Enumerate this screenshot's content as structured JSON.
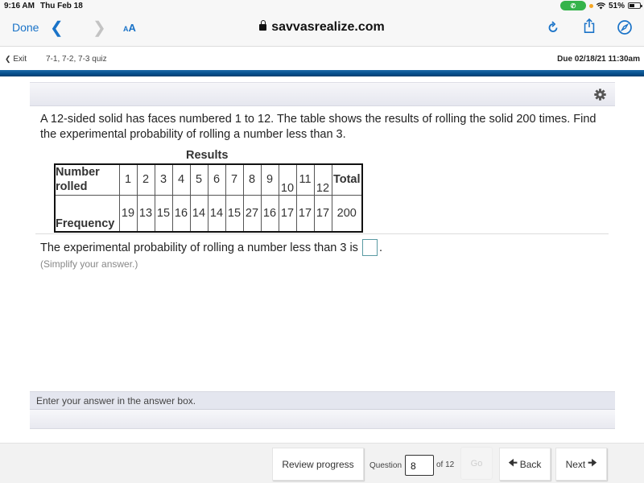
{
  "status_bar": {
    "time": "9:16 AM",
    "date": "Thu Feb 18",
    "battery_percent_label": "51%",
    "battery_level": 0.51,
    "icons": [
      "phone-call-icon",
      "mic-indicator-icon",
      "wifi-icon",
      "battery-icon"
    ]
  },
  "browser": {
    "done_label": "Done",
    "back_icon": "chevron-left-icon",
    "forward_icon": "chevron-right-icon",
    "text_size_label_small": "A",
    "text_size_label_large": "A",
    "url": "savvasrealize.com",
    "lock_icon": "lock-icon",
    "reload_icon": "reload-icon",
    "share_icon": "share-icon",
    "compass_icon": "compass-icon",
    "accent_color": "#1a73c8"
  },
  "app_bar": {
    "exit_label": "Exit",
    "quiz_title": "7-1, 7-2, 7-3 quiz",
    "due_label": "Due 02/18/21 11:30am",
    "brand_bar_color": "#064d8a"
  },
  "question": {
    "settings_icon": "gear-icon",
    "text": "A 12-sided solid has faces numbered 1 to 12. The table shows the results of rolling the solid 200 times. Find the experimental probability of rolling a number less than 3.",
    "table": {
      "title": "Results",
      "row1_header": "Number rolled",
      "row2_header": "Frequency",
      "numbers": [
        "1",
        "2",
        "3",
        "4",
        "5",
        "6",
        "7",
        "8",
        "9",
        "10",
        "11",
        "12"
      ],
      "frequencies": [
        "19",
        "13",
        "15",
        "16",
        "14",
        "14",
        "15",
        "27",
        "16",
        "17",
        "17",
        "17"
      ],
      "total_header": "Total",
      "total_value": "200"
    },
    "answer_prompt": "The experimental probability of rolling a number less than 3 is",
    "answer_suffix": ".",
    "answer_value": "",
    "hint": "(Simplify your answer.)"
  },
  "instructions": {
    "text": "Enter your answer in the answer box."
  },
  "footer": {
    "review_label": "Review progress",
    "question_label": "Question",
    "question_number": "8",
    "of_label": "of 12",
    "go_label": "Go",
    "back_label": "Back",
    "next_label": "Next",
    "back_icon": "arrow-left-icon",
    "next_icon": "arrow-right-icon"
  }
}
